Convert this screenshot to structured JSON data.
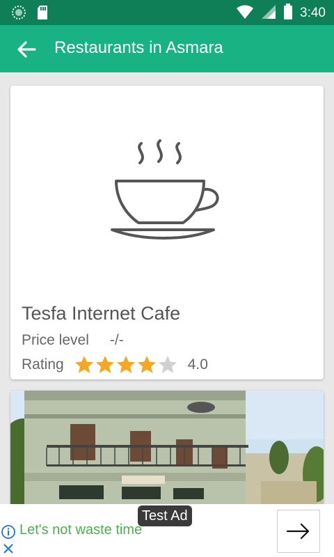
{
  "status_bar": {
    "time": "3:40",
    "icons": [
      "sync-icon",
      "sd-card-icon",
      "wifi-icon",
      "cell-signal-icon",
      "battery-icon"
    ]
  },
  "app_bar": {
    "title": "Restaurants in Asmara",
    "back_icon": "arrow-back-icon"
  },
  "restaurants": [
    {
      "name": "Tesfa Internet Cafe",
      "image": "coffee-cup-icon",
      "price_label": "Price level",
      "price_value": "-/-",
      "rating_label": "Rating",
      "rating": 4.0,
      "rating_text": "4.0",
      "rating_max": 5
    },
    {
      "image": "building-photo"
    }
  ],
  "ad": {
    "badge": "Test Ad",
    "text": "Let's not waste time",
    "info_icon": "info-icon",
    "close_icon": "close-icon",
    "action_icon": "arrow-right-icon"
  },
  "colors": {
    "status_bar": "#0f7f58",
    "app_bar": "#19b383",
    "star_filled": "#f5a623",
    "star_empty": "#d0d0d0",
    "ad_text": "#4caf50"
  }
}
